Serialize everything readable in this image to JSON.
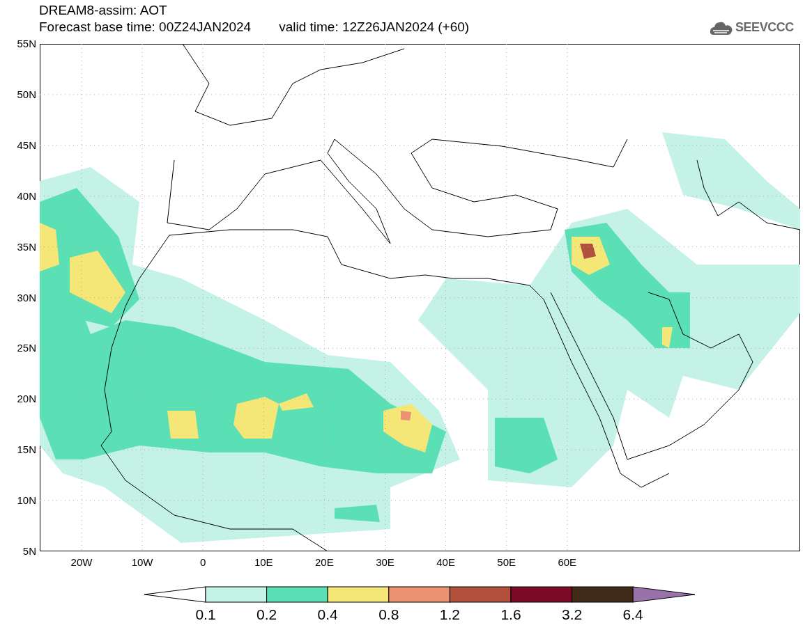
{
  "title": "DREAM8-assim: AOT",
  "base_time": "Forecast base time: 00Z24JAN2024",
  "valid_time": "valid time: 12Z26JAN2024 (+60)",
  "logo_text": "SEEVCCC",
  "y_labels": [
    "55N",
    "50N",
    "45N",
    "40N",
    "35N",
    "30N",
    "25N",
    "20N",
    "15N",
    "10N",
    "5N"
  ],
  "x_labels": [
    "20W",
    "10W",
    "0",
    "10E",
    "20E",
    "30E",
    "40E",
    "50E",
    "60E"
  ],
  "colorbar": {
    "bins": [
      {
        "kind": "triangle-left",
        "color": "#ffffff"
      },
      {
        "kind": "box",
        "color": "#c4f2e6"
      },
      {
        "kind": "box",
        "color": "#5ae0b4"
      },
      {
        "kind": "box",
        "color": "#f5e678"
      },
      {
        "kind": "box",
        "color": "#ec9272"
      },
      {
        "kind": "box",
        "color": "#b2503e"
      },
      {
        "kind": "box",
        "color": "#7c0a26"
      },
      {
        "kind": "box",
        "color": "#3e2a16"
      },
      {
        "kind": "triangle-right",
        "color": "#9872a8"
      }
    ],
    "labels": [
      "0.1",
      "0.2",
      "0.4",
      "0.8",
      "1.2",
      "1.6",
      "3.2",
      "6.4"
    ]
  }
}
